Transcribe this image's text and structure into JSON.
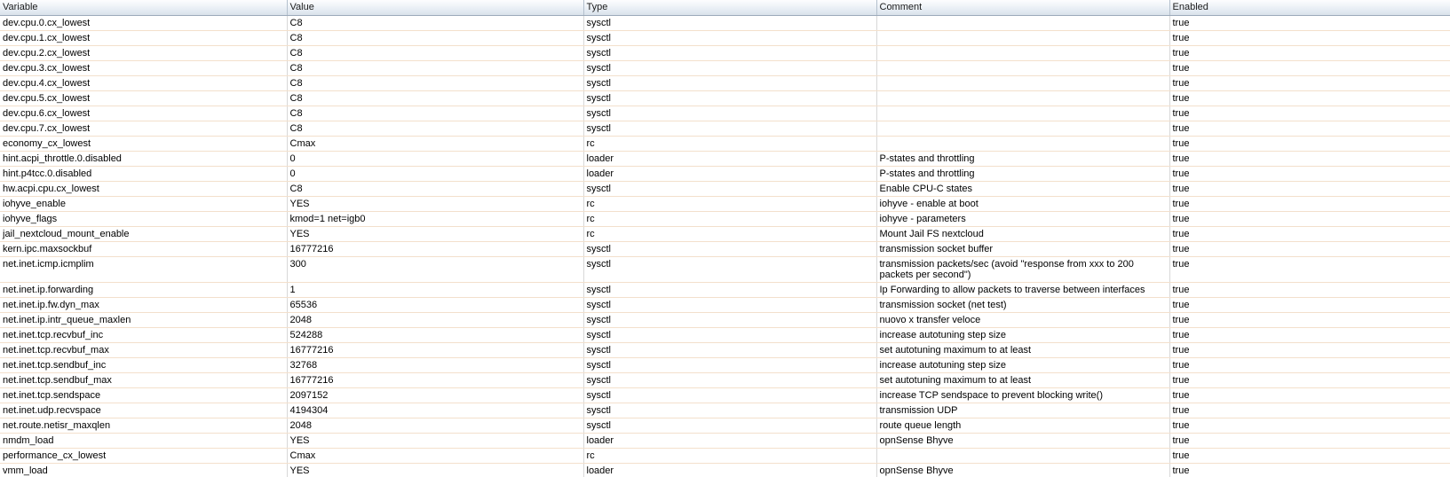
{
  "colors": {
    "header_gradient_top": "#fdfdfe",
    "header_gradient_bottom": "#d8e1ea",
    "header_border": "#9dabbb",
    "header_cell_divider": "#b4c0cd",
    "row_divider": "#f3e0cc",
    "column_divider": "#d8d8d8",
    "row_background": "#ffffff",
    "text": "#000000"
  },
  "table": {
    "columns": [
      {
        "label": "Variable"
      },
      {
        "label": "Value"
      },
      {
        "label": "Type"
      },
      {
        "label": "Comment"
      },
      {
        "label": "Enabled"
      }
    ],
    "rows": [
      {
        "variable": "dev.cpu.0.cx_lowest",
        "value": "C8",
        "type": "sysctl",
        "comment": "",
        "enabled": "true"
      },
      {
        "variable": "dev.cpu.1.cx_lowest",
        "value": "C8",
        "type": "sysctl",
        "comment": "",
        "enabled": "true"
      },
      {
        "variable": "dev.cpu.2.cx_lowest",
        "value": "C8",
        "type": "sysctl",
        "comment": "",
        "enabled": "true"
      },
      {
        "variable": "dev.cpu.3.cx_lowest",
        "value": "C8",
        "type": "sysctl",
        "comment": "",
        "enabled": "true"
      },
      {
        "variable": "dev.cpu.4.cx_lowest",
        "value": "C8",
        "type": "sysctl",
        "comment": "",
        "enabled": "true"
      },
      {
        "variable": "dev.cpu.5.cx_lowest",
        "value": "C8",
        "type": "sysctl",
        "comment": "",
        "enabled": "true"
      },
      {
        "variable": "dev.cpu.6.cx_lowest",
        "value": "C8",
        "type": "sysctl",
        "comment": "",
        "enabled": "true"
      },
      {
        "variable": "dev.cpu.7.cx_lowest",
        "value": "C8",
        "type": "sysctl",
        "comment": "",
        "enabled": "true"
      },
      {
        "variable": "economy_cx_lowest",
        "value": "Cmax",
        "type": "rc",
        "comment": "",
        "enabled": "true"
      },
      {
        "variable": "hint.acpi_throttle.0.disabled",
        "value": "0",
        "type": "loader",
        "comment": "P-states and throttling",
        "enabled": "true"
      },
      {
        "variable": "hint.p4tcc.0.disabled",
        "value": "0",
        "type": "loader",
        "comment": "P-states and throttling",
        "enabled": "true"
      },
      {
        "variable": "hw.acpi.cpu.cx_lowest",
        "value": "C8",
        "type": "sysctl",
        "comment": "Enable CPU-C states",
        "enabled": "true"
      },
      {
        "variable": "iohyve_enable",
        "value": "YES",
        "type": "rc",
        "comment": "iohyve - enable at boot",
        "enabled": "true"
      },
      {
        "variable": "iohyve_flags",
        "value": "kmod=1 net=igb0",
        "type": "rc",
        "comment": "iohyve - parameters",
        "enabled": "true"
      },
      {
        "variable": "jail_nextcloud_mount_enable",
        "value": "YES",
        "type": "rc",
        "comment": "Mount Jail FS nextcloud",
        "enabled": "true"
      },
      {
        "variable": "kern.ipc.maxsockbuf",
        "value": "16777216",
        "type": "sysctl",
        "comment": "transmission socket buffer",
        "enabled": "true"
      },
      {
        "variable": "net.inet.icmp.icmplim",
        "value": "300",
        "type": "sysctl",
        "comment": "transmission packets/sec (avoid \"response from xxx to 200 packets per second\")",
        "enabled": "true"
      },
      {
        "variable": "net.inet.ip.forwarding",
        "value": "1",
        "type": "sysctl",
        "comment": "Ip Forwarding to allow packets to traverse between interfaces",
        "enabled": "true"
      },
      {
        "variable": "net.inet.ip.fw.dyn_max",
        "value": "65536",
        "type": "sysctl",
        "comment": "transmission socket (net test)",
        "enabled": "true"
      },
      {
        "variable": "net.inet.ip.intr_queue_maxlen",
        "value": "2048",
        "type": "sysctl",
        "comment": "nuovo x transfer veloce",
        "enabled": "true"
      },
      {
        "variable": "net.inet.tcp.recvbuf_inc",
        "value": "524288",
        "type": "sysctl",
        "comment": "increase autotuning step size",
        "enabled": "true"
      },
      {
        "variable": "net.inet.tcp.recvbuf_max",
        "value": "16777216",
        "type": "sysctl",
        "comment": "set autotuning maximum to at least",
        "enabled": "true"
      },
      {
        "variable": "net.inet.tcp.sendbuf_inc",
        "value": "32768",
        "type": "sysctl",
        "comment": "increase autotuning step size",
        "enabled": "true"
      },
      {
        "variable": "net.inet.tcp.sendbuf_max",
        "value": "16777216",
        "type": "sysctl",
        "comment": "set autotuning maximum to at least",
        "enabled": "true"
      },
      {
        "variable": "net.inet.tcp.sendspace",
        "value": "2097152",
        "type": "sysctl",
        "comment": "increase TCP sendspace to prevent blocking write()",
        "enabled": "true"
      },
      {
        "variable": "net.inet.udp.recvspace",
        "value": "4194304",
        "type": "sysctl",
        "comment": "transmission UDP",
        "enabled": "true"
      },
      {
        "variable": "net.route.netisr_maxqlen",
        "value": "2048",
        "type": "sysctl",
        "comment": "route queue length",
        "enabled": "true"
      },
      {
        "variable": "nmdm_load",
        "value": "YES",
        "type": "loader",
        "comment": "opnSense Bhyve",
        "enabled": "true"
      },
      {
        "variable": "performance_cx_lowest",
        "value": "Cmax",
        "type": "rc",
        "comment": "",
        "enabled": "true"
      },
      {
        "variable": "vmm_load",
        "value": "YES",
        "type": "loader",
        "comment": "opnSense Bhyve",
        "enabled": "true"
      }
    ]
  }
}
